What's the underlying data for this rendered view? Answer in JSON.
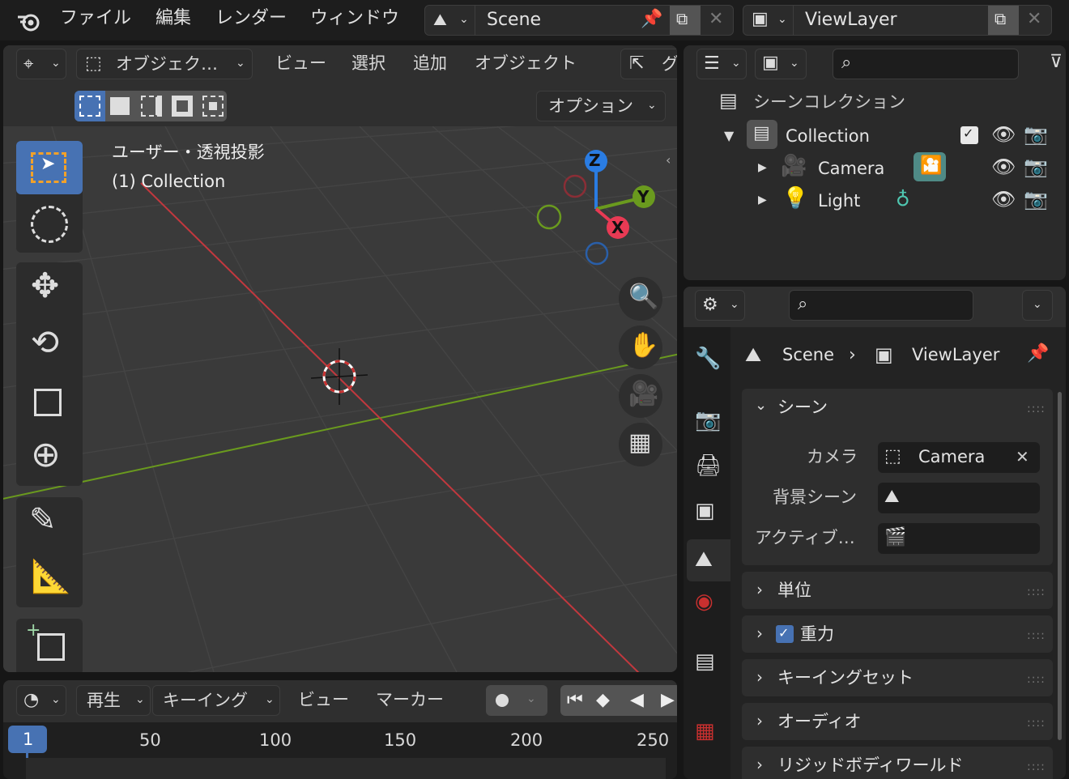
{
  "topbar": {
    "menus": [
      "ファイル",
      "編集",
      "レンダー",
      "ウィンドウ"
    ],
    "scene_name": "Scene",
    "viewlayer_name": "ViewLayer"
  },
  "viewport": {
    "header": {
      "mode_label": "オブジェク…",
      "menus": [
        "ビュー",
        "選択",
        "追加",
        "オブジェクト"
      ],
      "truncated_menu": "グ",
      "options_label": "オプション"
    },
    "overlay_text": {
      "view_name": "ユーザー・透視投影",
      "collection": "(1) Collection"
    },
    "gizmo": {
      "z": "Z",
      "y": "Y",
      "x": "X"
    },
    "colors": {
      "x_axis": "#c2383e",
      "y_axis": "#6a9a1e",
      "background": "#3a3a3a",
      "accent": "#4772b3"
    }
  },
  "timeline": {
    "menus": [
      "再生",
      "キーイング",
      "ビュー",
      "マーカー"
    ],
    "current_frame": "1",
    "ticks": [
      "50",
      "100",
      "150",
      "200",
      "250"
    ]
  },
  "outliner": {
    "root": "シーンコレクション",
    "collection": "Collection",
    "items": [
      {
        "name": "Camera",
        "icon": "camera-object-icon"
      },
      {
        "name": "Light",
        "icon": "light-object-icon"
      }
    ]
  },
  "properties": {
    "breadcrumb": {
      "scene": "Scene",
      "viewlayer": "ViewLayer"
    },
    "scene_panel": {
      "title": "シーン",
      "fields": [
        {
          "label": "カメラ",
          "value": "Camera"
        },
        {
          "label": "背景シーン",
          "value": ""
        },
        {
          "label": "アクティブ…",
          "value": ""
        }
      ]
    },
    "panels": [
      "単位",
      "重力",
      "キーイングセット",
      "オーディオ",
      "リジッドボディワールド"
    ],
    "gravity_checked": true
  }
}
